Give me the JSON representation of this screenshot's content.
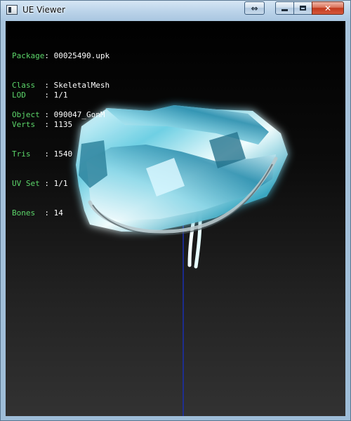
{
  "window": {
    "title": "UE Viewer"
  },
  "titlebar_buttons": {
    "swap_icon": "arrows-left-right-icon",
    "minimize_icon": "minimize-icon",
    "maximize_icon": "maximize-icon",
    "close_icon": "close-icon",
    "swap_glyph": "⇔",
    "close_glyph": "✕"
  },
  "info_top": [
    {
      "key": "Package",
      "sep": ": ",
      "value": "00025490.upk"
    },
    {
      "key": "Class  ",
      "sep": ": ",
      "value": "SkeletalMesh"
    },
    {
      "key": "Object ",
      "sep": ": ",
      "value": "090047_GonM"
    }
  ],
  "info_stats": [
    {
      "key": "LOD    ",
      "sep": ": ",
      "value": "1/1"
    },
    {
      "key": "Verts  ",
      "sep": ": ",
      "value": "1135"
    },
    {
      "key": "Tris   ",
      "sep": ": ",
      "value": "1540"
    },
    {
      "key": "UV Set ",
      "sep": ": ",
      "value": "1/1"
    },
    {
      "key": "Bones  ",
      "sep": ": ",
      "value": "14"
    }
  ],
  "colors": {
    "label": "#5cd66a",
    "value": "#ffffff",
    "axis": "#1a2fb0",
    "mesh_glow": "#9fe6f2"
  }
}
